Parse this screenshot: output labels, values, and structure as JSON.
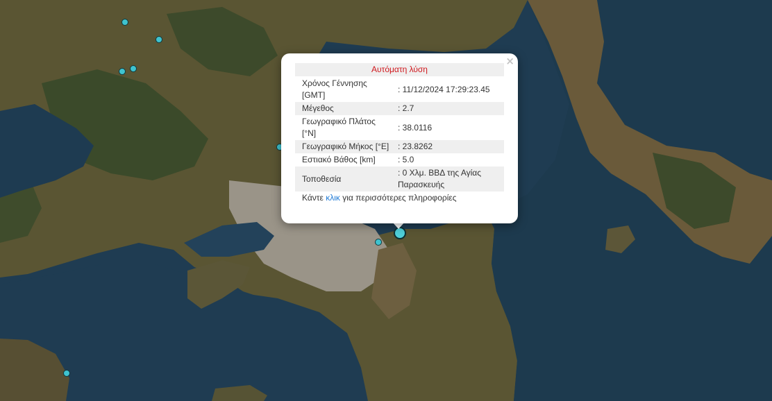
{
  "popup": {
    "title": "Αυτόματη λύση",
    "close": "×",
    "rows": [
      {
        "label": "Χρόνος Γέννησης [GMT]",
        "value": ": 11/12/2024 17:29:23.45"
      },
      {
        "label": "Μέγεθος",
        "value": ": 2.7"
      },
      {
        "label": "Γεωγραφικό Πλάτος [°N]",
        "value": ": 38.0116"
      },
      {
        "label": "Γεωγραφικό Μήκος [°E]",
        "value": ": 23.8262"
      },
      {
        "label": "Εστιακό Βάθος [km]",
        "value": ": 5.0"
      },
      {
        "label": "Τοποθεσία",
        "value": ": 0 Χλμ. ΒΒΔ της Αγίας Παρασκευής"
      }
    ],
    "footer_pre": "Κάντε ",
    "footer_link": "κλικ",
    "footer_post": " για περισσότερες πληροφορίες"
  },
  "markers": {
    "color": "#3fc3cf"
  }
}
